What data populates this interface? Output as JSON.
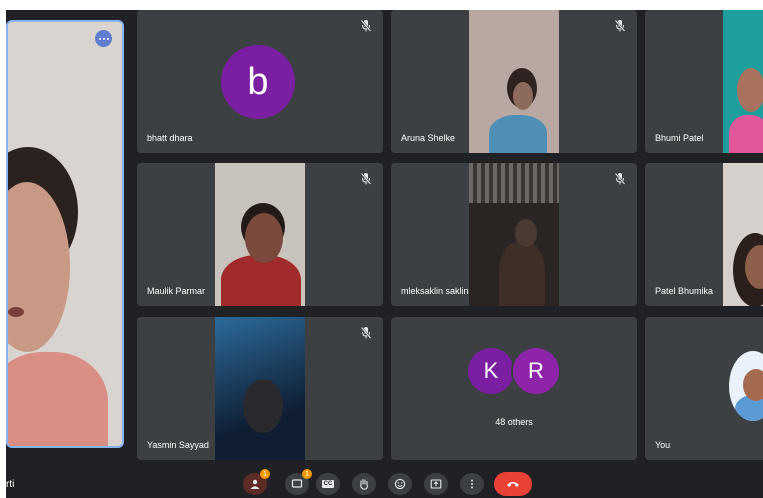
{
  "participants": [
    {
      "name": "bhatt dhara",
      "initial": "b",
      "avatar_color": "#7b1fa2",
      "muted": true
    },
    {
      "name": "Aruna Shelke",
      "muted": true
    },
    {
      "name": "Bhumi Patel",
      "muted": false
    },
    {
      "name": "Maulik Parmar",
      "muted": true
    },
    {
      "name": "mleksaklin saklin",
      "muted": true
    },
    {
      "name": "Patel Bhumika",
      "muted": false
    },
    {
      "name": "Yasmin Sayyad",
      "muted": true
    },
    {
      "name": "You",
      "muted": false
    }
  ],
  "others_tile": {
    "label": "48 others",
    "avatars": [
      {
        "initial": "K",
        "color": "#7b1fa2"
      },
      {
        "initial": "R",
        "color": "#8e24aa"
      }
    ]
  },
  "presenter_name_fragment": "rti",
  "toolbar": {
    "people_badge": "1",
    "chat_badge": "1",
    "captions_label": "CC"
  },
  "colors": {
    "tile_bg": "#3c4043",
    "stage_bg": "#202124",
    "leave_red": "#ea4335",
    "badge_orange": "#f29900",
    "active_speaker_border": "#8ab4f8"
  }
}
